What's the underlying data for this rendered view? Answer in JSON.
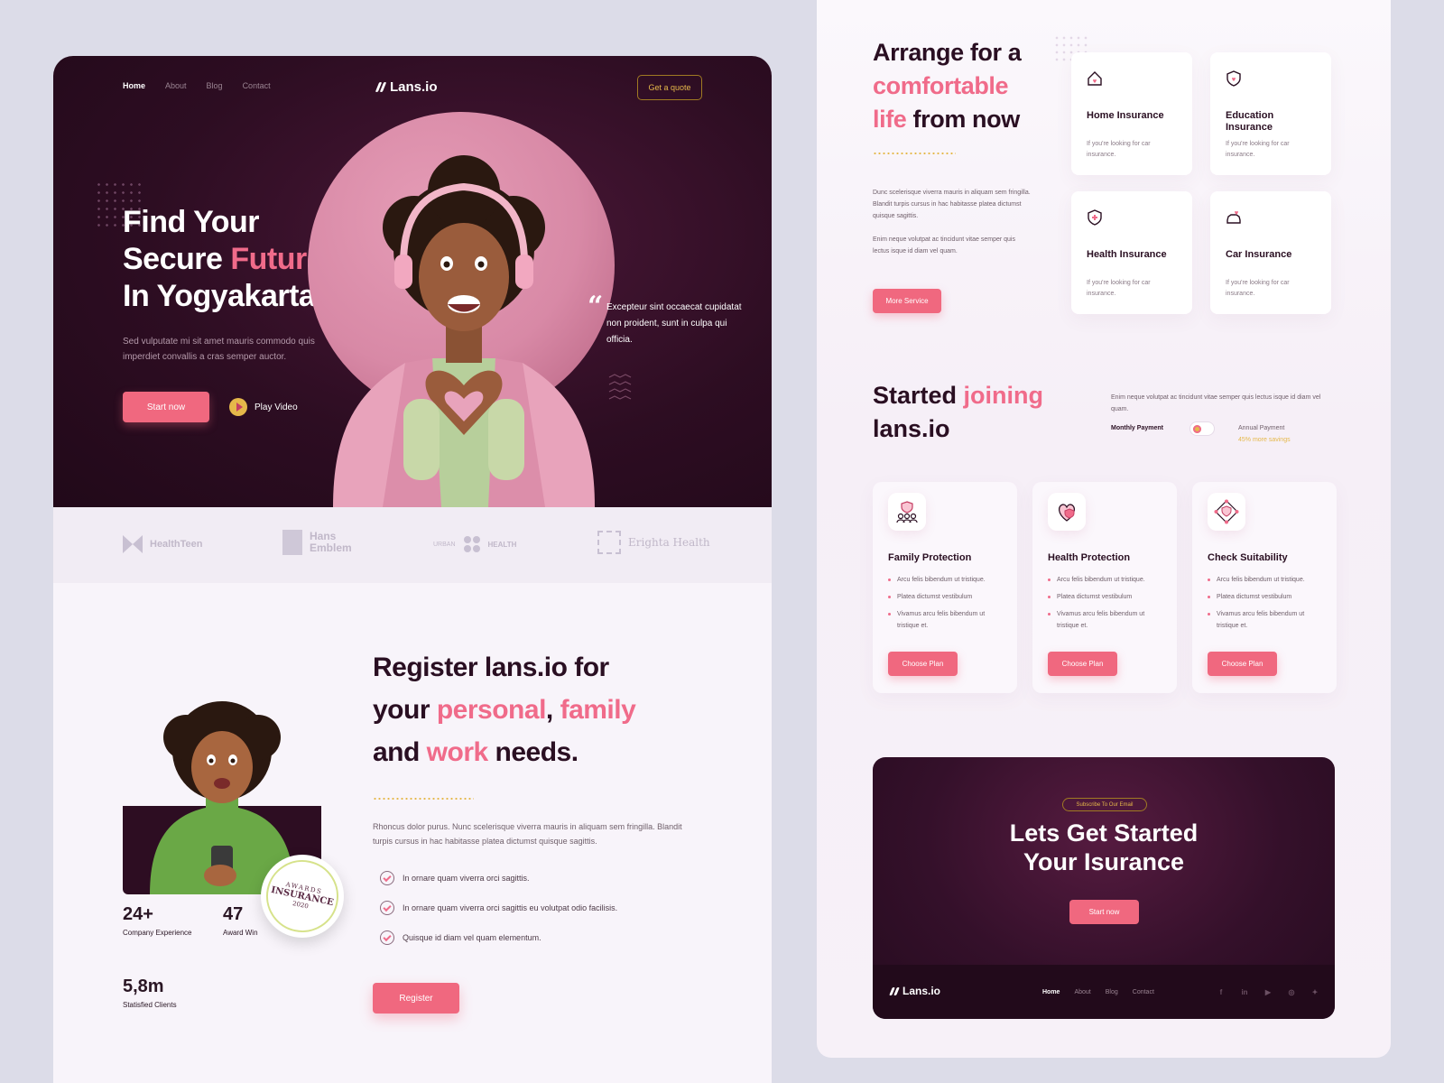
{
  "hero": {
    "nav": [
      "Home",
      "About",
      "Blog",
      "Contact"
    ],
    "logo": "Lans.io",
    "quote_btn": "Get a quote",
    "title_line1": "Find Your",
    "title_line2a": "Secure ",
    "title_line2b": "Future",
    "title_line3": "In Yogyakarta",
    "subtitle": "Sed vulputate mi sit amet mauris commodo quis imperdiet convallis a cras semper auctor.",
    "start_btn": "Start now",
    "play_label": "Play Video",
    "quote": "Excepteur sint occaecat cupidatat non proident, sunt in culpa qui officia."
  },
  "partners": [
    {
      "name": "HealthTeen"
    },
    {
      "name": "Hans Emblem"
    },
    {
      "name_a": "URBAN",
      "name_b": "HEALTH"
    },
    {
      "name": "Erighta Health"
    }
  ],
  "register": {
    "title_a": "Register lans.io for",
    "title_b": "your ",
    "title_c": "personal",
    "title_d": ", ",
    "title_e": "family",
    "title_f": "and ",
    "title_g": "work",
    "title_h": " needs.",
    "desc": "Rhoncus dolor purus. Nunc scelerisque viverra mauris in aliquam sem fringilla. Blandit turpis cursus in hac habitasse platea dictumst quisque sagittis.",
    "checks": [
      "In ornare quam viverra orci sagittis.",
      "In ornare quam viverra orci sagittis eu volutpat odio facilisis.",
      "Quisque id diam vel quam elementum."
    ],
    "button": "Register",
    "badge": {
      "l1": "AWARDS",
      "l2": "INSURANCE",
      "l3": "2020"
    },
    "stats": [
      {
        "num": "24+",
        "label": "Company Experience"
      },
      {
        "num": "47",
        "label": "Award Win"
      },
      {
        "num": "5,8m",
        "label": "Statisfied Clients"
      }
    ]
  },
  "arrange": {
    "title_a": "Arrange for a",
    "title_b": "comfortable",
    "title_c": "life",
    "title_d": " from now",
    "p1": "Dunc scelerisque viverra mauris in aliquam sem fringilla. Blandit turpis cursus in hac habitasse platea dictumst quisque sagittis.",
    "p2": "Enim neque volutpat ac tincidunt vitae semper quis lectus isque id diam vel quam.",
    "more_btn": "More Service",
    "cards": [
      {
        "title": "Home Insurance",
        "desc": "If you're looking for car insurance.",
        "icon": "home-heart-icon"
      },
      {
        "title": "Education Insurance",
        "desc": "If you're looking for car insurance.",
        "icon": "shield-heart-icon"
      },
      {
        "title": "Health Insurance",
        "desc": "If you're looking for car insurance.",
        "icon": "shield-plus-icon"
      },
      {
        "title": "Car Insurance",
        "desc": "If you're looking for car insurance.",
        "icon": "car-heart-icon"
      }
    ]
  },
  "join": {
    "title_a": "Started ",
    "title_b": "joining",
    "title_c": "lans.io",
    "desc": "Enim neque volutpat ac tincidunt vitae semper quis lectus isque id diam vel quam.",
    "monthly": "Monthly Payment",
    "annual": "Annual Payment",
    "savings": "45% more savings"
  },
  "plans": [
    {
      "title": "Family Protection",
      "icon": "family-shield-icon",
      "items": [
        "Arcu felis bibendum ut tristique.",
        "Platea dictumst vestibulum",
        "Vivamus arcu felis bibendum ut tristique et."
      ],
      "button": "Choose Plan"
    },
    {
      "title": "Health Protection",
      "icon": "heart-shield-icon",
      "items": [
        "Arcu felis bibendum ut tristique.",
        "Platea dictumst vestibulum",
        "Vivamus arcu felis bibendum ut tristique et."
      ],
      "button": "Choose Plan"
    },
    {
      "title": "Check Suitability",
      "icon": "network-shield-icon",
      "items": [
        "Arcu felis bibendum ut tristique.",
        "Platea dictumst vestibulum",
        "Vivamus arcu felis bibendum ut tristique et."
      ],
      "button": "Choose Plan"
    }
  ],
  "cta": {
    "pill": "Subscribe To Our Email",
    "title_a": "Lets Get Started",
    "title_b": "Your Isurance",
    "button": "Start now"
  },
  "footer": {
    "logo": "Lans.io",
    "nav": [
      "Home",
      "About",
      "Blog",
      "Contact"
    ],
    "social": [
      "facebook-icon",
      "linkedin-icon",
      "youtube-icon",
      "instagram-icon",
      "twitter-icon"
    ]
  },
  "colors": {
    "accent": "#f0687f",
    "dark": "#2d0d22",
    "gold": "#e5b84a"
  }
}
